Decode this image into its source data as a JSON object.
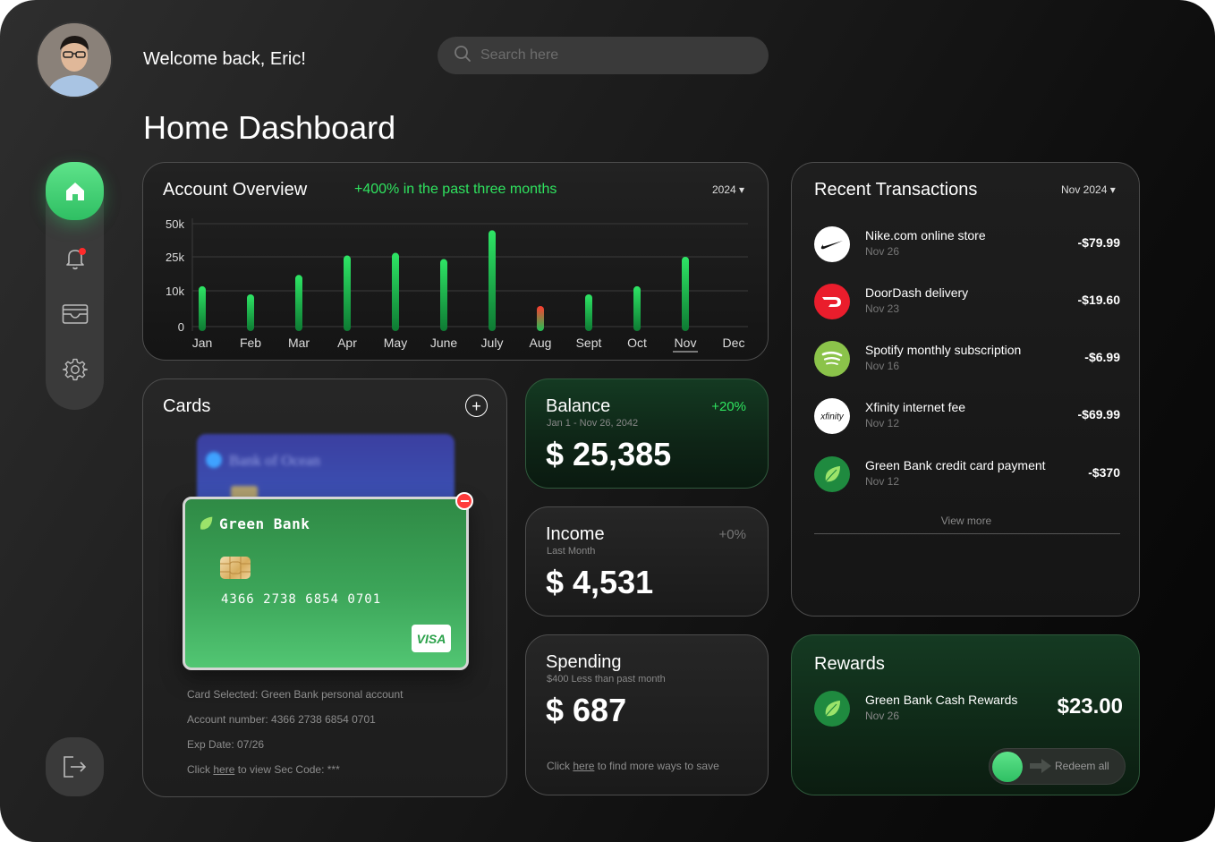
{
  "header": {
    "welcome": "Welcome back, Eric!",
    "search_placeholder": "Search here",
    "page_title": "Home Dashboard"
  },
  "sidebar": {
    "items": [
      {
        "icon": "home-icon",
        "active": true
      },
      {
        "icon": "bell-icon",
        "has_notification": true
      },
      {
        "icon": "wallet-icon"
      },
      {
        "icon": "gear-icon"
      }
    ],
    "logout_icon": "logout-icon"
  },
  "overview": {
    "title": "Account Overview",
    "growth": "+400% in the past three months",
    "year_selector": "2024 ▾"
  },
  "chart_data": {
    "type": "bar",
    "categories": [
      "Jan",
      "Feb",
      "Mar",
      "Apr",
      "May",
      "June",
      "July",
      "Aug",
      "Sept",
      "Oct",
      "Nov",
      "Dec"
    ],
    "values": [
      12000,
      9000,
      17000,
      26000,
      28000,
      24000,
      45000,
      0,
      9000,
      12000,
      25000,
      null
    ],
    "y_ticks": [
      "50k",
      "25k",
      "10k",
      "0"
    ],
    "selected_category": "Nov",
    "colors": {
      "normal": "#22c55e",
      "negative": "#ff3b30"
    },
    "note": ""
  },
  "transactions": {
    "title": "Recent Transactions",
    "month_selector": "Nov 2024 ▾",
    "items": [
      {
        "name": "Nike.com online store",
        "date": "Nov 26",
        "amount": "-$79.99",
        "logo": "nike-logo-icon"
      },
      {
        "name": "DoorDash delivery",
        "date": "Nov 23",
        "amount": "-$19.60",
        "logo": "doordash-logo-icon"
      },
      {
        "name": "Spotify monthly subscription",
        "date": "Nov 16",
        "amount": "-$6.99",
        "logo": "spotify-logo-icon"
      },
      {
        "name": "Xfinity internet fee",
        "date": "Nov 12",
        "amount": "-$69.99",
        "logo": "xfinity-logo-icon"
      },
      {
        "name": "Green Bank credit card payment",
        "date": "Nov 12",
        "amount": "-$370",
        "logo": "green-bank-logo-icon"
      }
    ],
    "view_more": "View more"
  },
  "cards": {
    "title": "Cards",
    "add_label": "+",
    "back_card": {
      "bank": "Bank of Ocean"
    },
    "front_card": {
      "bank": "Green Bank",
      "number": "4366 2738 6854 0701",
      "network": "VISA"
    },
    "info": {
      "selected": "Card Selected: Green Bank personal account",
      "account": "Account number: 4366 2738 6854 0701",
      "exp": "Exp Date: 07/26",
      "sec_prefix": "Click ",
      "sec_link": "here",
      "sec_suffix": " to view Sec Code: ***"
    }
  },
  "balance": {
    "label": "Balance",
    "range": "Jan 1 - Nov 26, 2042",
    "change": "+20%",
    "value": "$ 25,385"
  },
  "income": {
    "label": "Income",
    "range": "Last Month",
    "change": "+0%",
    "value": "$ 4,531"
  },
  "spending": {
    "label": "Spending",
    "range": "$400 Less than past month",
    "value": "$ 687",
    "note_prefix": "Click ",
    "note_link": "here",
    "note_suffix": " to find more ways to save"
  },
  "rewards": {
    "title": "Rewards",
    "name": "Green Bank Cash Rewards",
    "date": "Nov 26",
    "amount": "$23.00",
    "redeem_label": "Redeem all"
  },
  "colors": {
    "accent": "#2fe35f",
    "brand_green": "#3ca559",
    "danger": "#ff3b3b"
  }
}
